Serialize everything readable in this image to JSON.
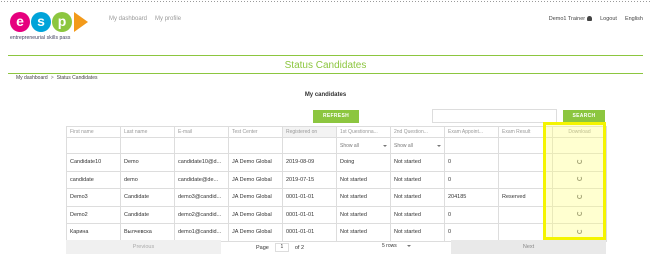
{
  "logo": {
    "letters": [
      "e",
      "s",
      "p"
    ],
    "colors": [
      "#e6007e",
      "#00a3d9",
      "#8cc63f"
    ],
    "arrow_color": "#f39a1a",
    "subtitle": "entrepreneurial skills pass"
  },
  "nav": {
    "dashboard": "My dashboard",
    "profile": "My profile"
  },
  "user": {
    "name": "Demo1 Trainer",
    "logout": "Logout",
    "language": "English"
  },
  "page_title": "Status Candidates",
  "breadcrumb": {
    "home": "My dashboard",
    "sep": ">",
    "current": "Status Candidates"
  },
  "section_title": "My candidates",
  "refresh_label": "REFRESH",
  "search": {
    "value": "",
    "button": "SEARCH"
  },
  "table": {
    "headers": [
      "First name",
      "Last name",
      "E-mail",
      "Test Center",
      "Registered on",
      "1st Questionna...",
      "2nd Question...",
      "Exam Appoint...",
      "Exam Result",
      "Download"
    ],
    "filter_label": "Show all",
    "rows": [
      [
        "Candidate10",
        "Demo",
        "candidate10@d...",
        "JA Demo Global",
        "2019-08-09",
        "Doing",
        "Not started",
        "0",
        ""
      ],
      [
        "candidate",
        "demo",
        "candidate@de...",
        "JA Demo Global",
        "2019-07-15",
        "Not started",
        "Not started",
        "0",
        ""
      ],
      [
        "Demo3",
        "Candidate",
        "demo3@candid...",
        "JA Demo Global",
        "0001-01-01",
        "Not started",
        "Not started",
        "204185",
        "Reserved"
      ],
      [
        "Demo2",
        "Candidate",
        "demo2@candid...",
        "JA Demo Global",
        "0001-01-01",
        "Not started",
        "Not started",
        "0",
        ""
      ],
      [
        "Карина",
        "Вылчевска",
        "demo1@candid...",
        "JA Demo Global",
        "0001-01-01",
        "Not started",
        "Not started",
        "0",
        ""
      ]
    ]
  },
  "pager": {
    "previous": "Previous",
    "page_label": "Page",
    "page_value": "1",
    "of_label": "of 2",
    "rows_label": "5 rows",
    "next": "Next"
  },
  "highlight_color": "#f4f400",
  "accent_color": "#8cc63f"
}
